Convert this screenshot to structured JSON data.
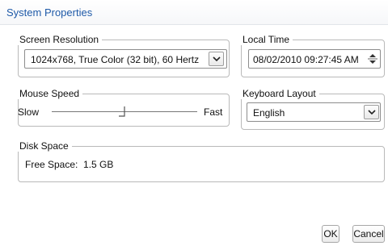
{
  "window": {
    "title": "System Properties"
  },
  "screen_resolution": {
    "legend": "Screen Resolution",
    "selected": "1024x768, True Color (32 bit), 60 Hertz"
  },
  "local_time": {
    "legend": "Local Time",
    "value": "08/02/2010 09:27:45 AM"
  },
  "mouse_speed": {
    "legend": "Mouse Speed",
    "min_label": "Slow",
    "max_label": "Fast",
    "level_fraction": 0.5
  },
  "keyboard_layout": {
    "legend": "Keyboard Layout",
    "selected": "English"
  },
  "disk_space": {
    "legend": "Disk Space",
    "free_space_text": "Free Space:  1.5 GB"
  },
  "buttons": {
    "ok_label": "OK",
    "cancel_label": "Cancel"
  },
  "icons": {
    "dropdown": "chevron-down-icon",
    "spin_up": "spin-up-icon",
    "spin_down": "spin-down-icon",
    "slider_thumb": "slider-thumb-icon"
  }
}
